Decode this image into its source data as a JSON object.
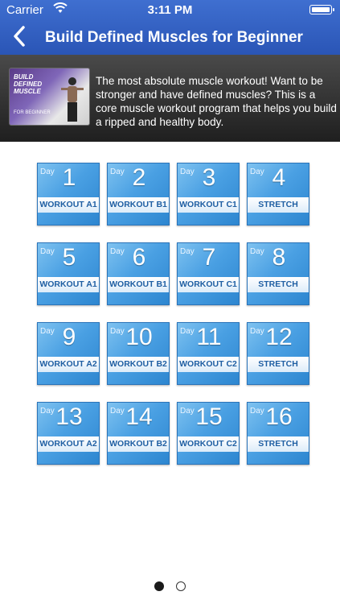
{
  "status_bar": {
    "carrier": "Carrier",
    "time": "3:11 PM"
  },
  "nav": {
    "title": "Build Defined Muscles for Beginner"
  },
  "banner": {
    "thumb_title": "BUILD DEFINED MUSCLE",
    "thumb_subtitle": "FOR BEGINNER",
    "description": "The most absolute muscle workout! Want to be stronger and have defined muscles? This is a core muscle workout program that helps you build a ripped and healthy body."
  },
  "days": [
    {
      "day": "Day",
      "num": "1",
      "label": "WORKOUT A1"
    },
    {
      "day": "Day",
      "num": "2",
      "label": "WORKOUT B1"
    },
    {
      "day": "Day",
      "num": "3",
      "label": "WORKOUT C1"
    },
    {
      "day": "Day",
      "num": "4",
      "label": "STRETCH"
    },
    {
      "day": "Day",
      "num": "5",
      "label": "WORKOUT A1"
    },
    {
      "day": "Day",
      "num": "6",
      "label": "WORKOUT B1"
    },
    {
      "day": "Day",
      "num": "7",
      "label": "WORKOUT C1"
    },
    {
      "day": "Day",
      "num": "8",
      "label": "STRETCH"
    },
    {
      "day": "Day",
      "num": "9",
      "label": "WORKOUT A2"
    },
    {
      "day": "Day",
      "num": "10",
      "label": "WORKOUT B2"
    },
    {
      "day": "Day",
      "num": "11",
      "label": "WORKOUT C2"
    },
    {
      "day": "Day",
      "num": "12",
      "label": "STRETCH"
    },
    {
      "day": "Day",
      "num": "13",
      "label": "WORKOUT A2"
    },
    {
      "day": "Day",
      "num": "14",
      "label": "WORKOUT B2"
    },
    {
      "day": "Day",
      "num": "15",
      "label": "WORKOUT C2"
    },
    {
      "day": "Day",
      "num": "16",
      "label": "STRETCH"
    }
  ],
  "page_control": {
    "total": 2,
    "current": 1
  },
  "colors": {
    "nav_blue": "#2f5fc2",
    "tile_blue": "#4aa0e3",
    "label_text": "#1f5fa3"
  }
}
